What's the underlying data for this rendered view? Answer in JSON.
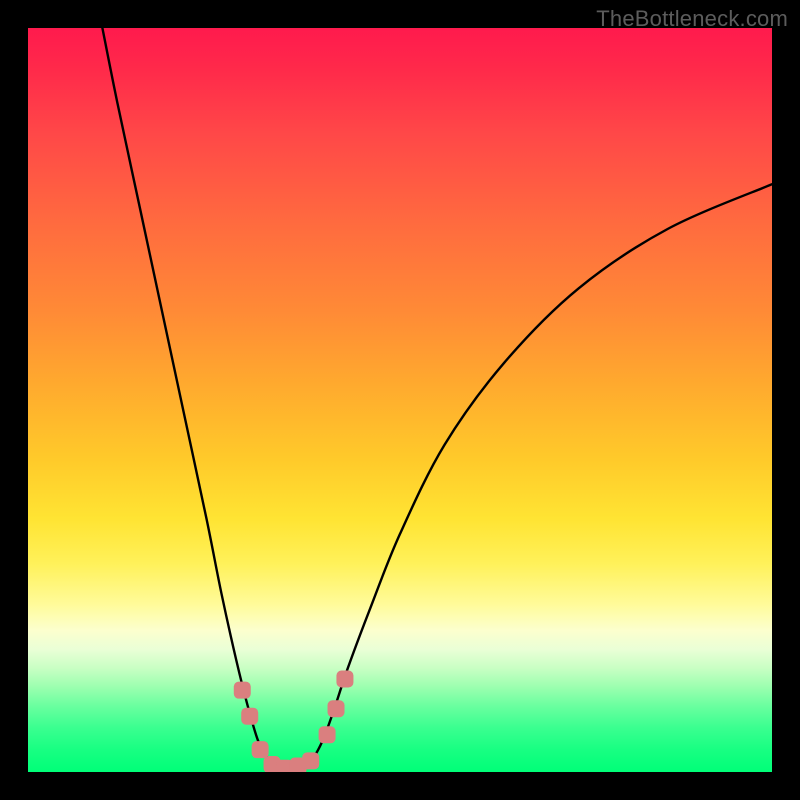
{
  "watermark": "TheBottleneck.com",
  "chart_data": {
    "type": "line",
    "title": "",
    "xlabel": "",
    "ylabel": "",
    "xlim": [
      0,
      100
    ],
    "ylim": [
      0,
      100
    ],
    "background_gradient": {
      "top_color": "#ff1a4d",
      "mid_color": "#ffe433",
      "bottom_color": "#00ff78"
    },
    "series": [
      {
        "name": "curve",
        "type": "line",
        "color": "#000000",
        "points": [
          {
            "x": 10.0,
            "y": 100.0
          },
          {
            "x": 12.0,
            "y": 90.0
          },
          {
            "x": 15.0,
            "y": 76.0
          },
          {
            "x": 18.0,
            "y": 62.0
          },
          {
            "x": 21.0,
            "y": 48.0
          },
          {
            "x": 24.0,
            "y": 34.0
          },
          {
            "x": 26.0,
            "y": 24.0
          },
          {
            "x": 28.0,
            "y": 15.0
          },
          {
            "x": 29.5,
            "y": 9.0
          },
          {
            "x": 31.0,
            "y": 4.0
          },
          {
            "x": 32.5,
            "y": 1.5
          },
          {
            "x": 34.0,
            "y": 0.5
          },
          {
            "x": 36.0,
            "y": 0.5
          },
          {
            "x": 38.0,
            "y": 1.5
          },
          {
            "x": 39.5,
            "y": 4.0
          },
          {
            "x": 41.0,
            "y": 8.0
          },
          {
            "x": 43.0,
            "y": 14.0
          },
          {
            "x": 46.0,
            "y": 22.0
          },
          {
            "x": 50.0,
            "y": 32.0
          },
          {
            "x": 56.0,
            "y": 44.0
          },
          {
            "x": 64.0,
            "y": 55.0
          },
          {
            "x": 74.0,
            "y": 65.0
          },
          {
            "x": 86.0,
            "y": 73.0
          },
          {
            "x": 100.0,
            "y": 79.0
          }
        ]
      },
      {
        "name": "markers",
        "type": "scatter",
        "color": "#da7f7f",
        "points": [
          {
            "x": 28.8,
            "y": 11.0
          },
          {
            "x": 29.8,
            "y": 7.5
          },
          {
            "x": 31.2,
            "y": 3.0
          },
          {
            "x": 32.8,
            "y": 1.0
          },
          {
            "x": 34.5,
            "y": 0.5
          },
          {
            "x": 36.3,
            "y": 0.8
          },
          {
            "x": 38.0,
            "y": 1.5
          },
          {
            "x": 40.2,
            "y": 5.0
          },
          {
            "x": 41.4,
            "y": 8.5
          },
          {
            "x": 42.6,
            "y": 12.5
          }
        ]
      }
    ]
  }
}
